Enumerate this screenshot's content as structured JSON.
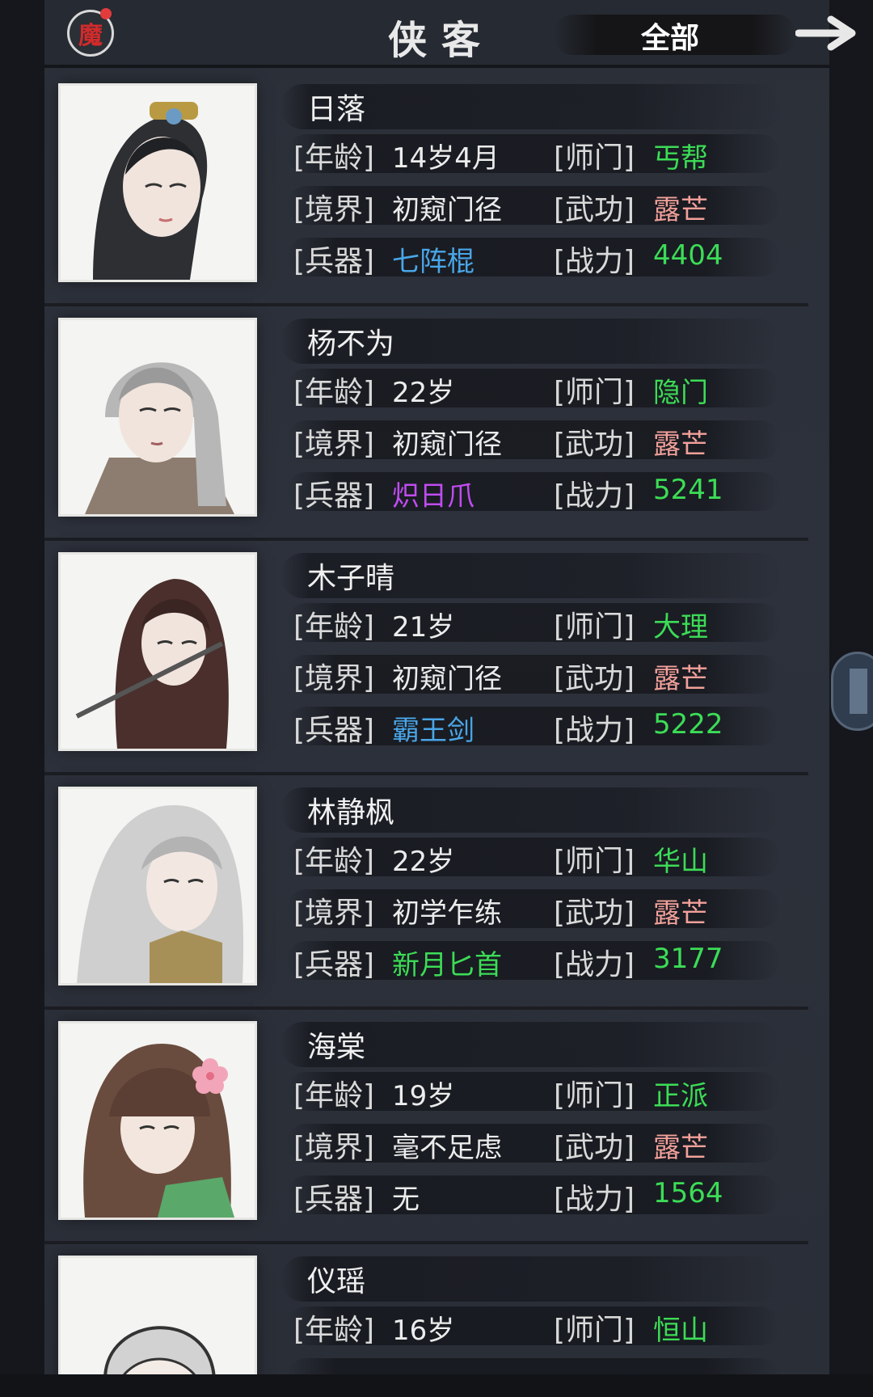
{
  "header": {
    "seal_char": "魔",
    "title": "侠客",
    "filter_label": "全部"
  },
  "labels": {
    "age": "[年龄]",
    "realm": "[境界]",
    "weapon": "[兵器]",
    "sect": "[师门]",
    "skill": "[武功]",
    "power": "[战力]"
  },
  "heroes": [
    {
      "name": "日落",
      "age": "14岁4月",
      "realm": "初窥门径",
      "weapon": "七阵棍",
      "sect": "丐帮",
      "skill": "露芒",
      "power": "4404"
    },
    {
      "name": "杨不为",
      "age": "22岁",
      "realm": "初窥门径",
      "weapon": "炽日爪",
      "sect": "隐门",
      "skill": "露芒",
      "power": "5241"
    },
    {
      "name": "木子晴",
      "age": "21岁",
      "realm": "初窥门径",
      "weapon": "霸王剑",
      "sect": "大理",
      "skill": "露芒",
      "power": "5222"
    },
    {
      "name": "林静枫",
      "age": "22岁",
      "realm": "初学乍练",
      "weapon": "新月匕首",
      "sect": "华山",
      "skill": "露芒",
      "power": "3177"
    },
    {
      "name": "海棠",
      "age": "19岁",
      "realm": "毫不足虑",
      "weapon": "无",
      "sect": "正派",
      "skill": "露芒",
      "power": "1564"
    },
    {
      "name": "仪瑶",
      "age": "16岁",
      "sect": "恒山"
    }
  ],
  "colors": {
    "green": "#3cdc56",
    "pink": "#f2a09a",
    "blue": "#4aa6e8",
    "purple": "#c04cf0"
  },
  "icons": {
    "seal": "demon-seal-icon",
    "next": "arrow-right-icon",
    "portrait": "portrait-icon"
  }
}
